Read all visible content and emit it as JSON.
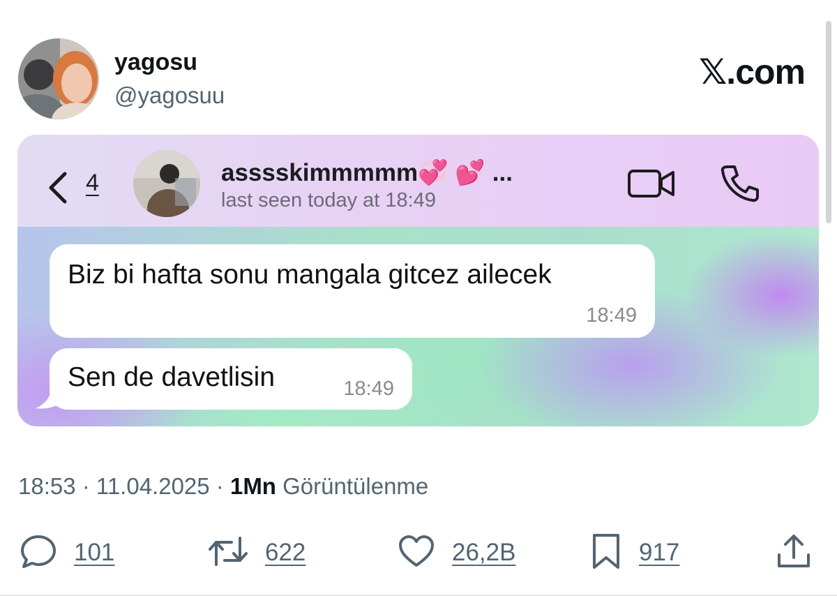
{
  "tweet": {
    "display_name": "yagosu",
    "handle": "@yagosuu",
    "brand": "𝕏.com"
  },
  "chat": {
    "back_count": "4",
    "contact_name": "asssskimmmmm",
    "contact_emoji": "💞 💕",
    "contact_more": "...",
    "status": "last seen today at 18:49",
    "messages": [
      {
        "text": "Biz bi hafta sonu mangala gitcez ailecek",
        "time": "18:49"
      },
      {
        "text": "Sen de davetlisin",
        "time": "18:49"
      }
    ]
  },
  "meta": {
    "time": "18:53",
    "date": "11.04.2025",
    "separator": " · ",
    "views_count": "1Mn",
    "views_label": "Görüntülenme"
  },
  "actions": {
    "replies": "101",
    "reposts": "622",
    "likes": "26,2B",
    "bookmarks": "917"
  },
  "icons": {
    "back": "chevron-left-icon",
    "video": "video-camera-icon",
    "phone": "phone-icon",
    "reply": "speech-bubble-icon",
    "repost": "repost-arrows-icon",
    "like": "heart-icon",
    "bookmark": "bookmark-icon",
    "share": "share-upload-icon"
  },
  "colors": {
    "text_primary": "#0f1419",
    "text_secondary": "#536471",
    "emoji_pink": "#f03ea1"
  }
}
